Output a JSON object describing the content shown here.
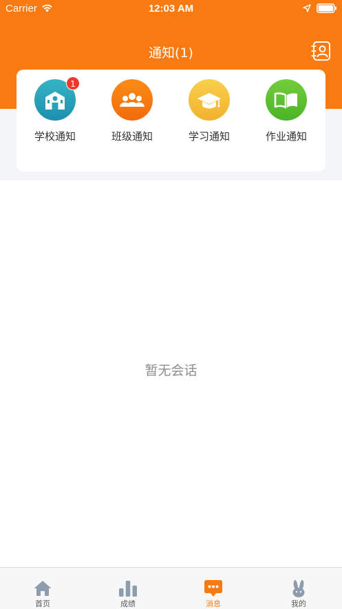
{
  "status_bar": {
    "carrier": "Carrier",
    "time": "12:03 AM",
    "wifi_icon": "wifi-icon",
    "location_icon": "location-arrow-icon",
    "battery_icon": "battery-icon"
  },
  "header": {
    "title": "通知(1)",
    "contacts_icon": "contacts-book-icon",
    "background_color": "#f97a11"
  },
  "categories": [
    {
      "label": "学校通知",
      "icon": "school-building-icon",
      "color": "#1f9bb4",
      "badge": "1"
    },
    {
      "label": "班级通知",
      "icon": "group-people-icon",
      "color": "#f87510"
    },
    {
      "label": "学习通知",
      "icon": "graduation-cap-icon",
      "color": "#f5bc2c"
    },
    {
      "label": "作业通知",
      "icon": "open-book-icon",
      "color": "#58c02f"
    }
  ],
  "empty_state": {
    "text": "暂无会话"
  },
  "tab_bar": {
    "active_color": "#f97a11",
    "inactive_color": "#8e9dae",
    "items": [
      {
        "label": "首页",
        "icon": "home-icon",
        "active": false
      },
      {
        "label": "成绩",
        "icon": "bar-chart-icon",
        "active": false
      },
      {
        "label": "消息",
        "icon": "chat-bubble-icon",
        "active": true
      },
      {
        "label": "我的",
        "icon": "rabbit-icon",
        "active": false
      }
    ]
  }
}
